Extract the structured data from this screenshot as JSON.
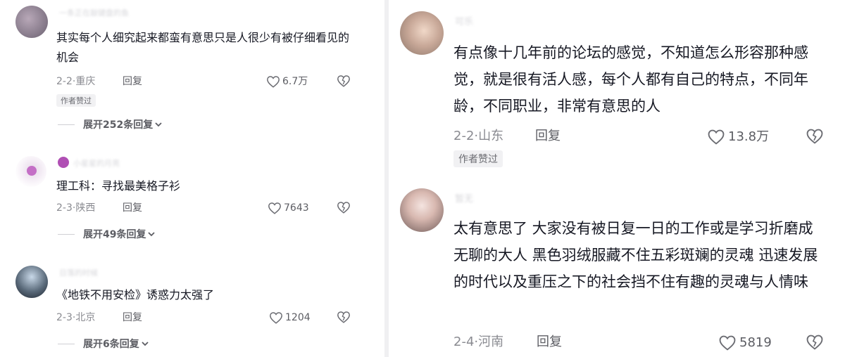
{
  "left_panel": {
    "comments": [
      {
        "username": "一条正在敲键盘的鱼",
        "text": "其实每个人细究起来都蛮有意思只是人很少有被仔细看见的机会",
        "date": "2-2",
        "location": "重庆",
        "reply_label": "回复",
        "likes": "6.7万",
        "badge": "作者赞过",
        "expand_label": "展开252条回复"
      },
      {
        "username": "小星星的月亮",
        "text": "理工科：寻找最美格子衫",
        "date": "2-3",
        "location": "陕西",
        "reply_label": "回复",
        "likes": "7643",
        "expand_label": "展开49条回复"
      },
      {
        "username": "日落的时候",
        "text": "《地铁不用安检》诱惑力太强了",
        "date": "2-3",
        "location": "北京",
        "reply_label": "回复",
        "likes": "1204",
        "expand_label": "展开6条回复"
      }
    ]
  },
  "right_panel": {
    "comments": [
      {
        "username": "可乐",
        "text": "有点像十几年前的论坛的感觉，不知道怎么形容那种感觉，就是很有活人感，每个人都有自己的特点，不同年龄，不同职业，非常有意思的人",
        "date": "2-2",
        "location": "山东",
        "reply_label": "回复",
        "likes": "13.8万",
        "badge": "作者赞过"
      },
      {
        "username": "暂无",
        "text": "太有意思了 大家没有被日复一日的工作或是学习折磨成无聊的大人 黑色羽绒服藏不住五彩斑斓的灵魂 迅速发展的时代以及重压之下的社会挡不住有趣的灵魂与人情味",
        "date": "2-4",
        "location": "河南",
        "reply_label": "回复",
        "likes": "5819"
      }
    ]
  },
  "icons": {
    "like": "heart-outline-icon",
    "dislike": "broken-heart-icon",
    "expand": "chevron-down-icon"
  },
  "colors": {
    "text": "#161823",
    "meta": "#8a8b91",
    "badge_bg": "#f1f1f3"
  }
}
